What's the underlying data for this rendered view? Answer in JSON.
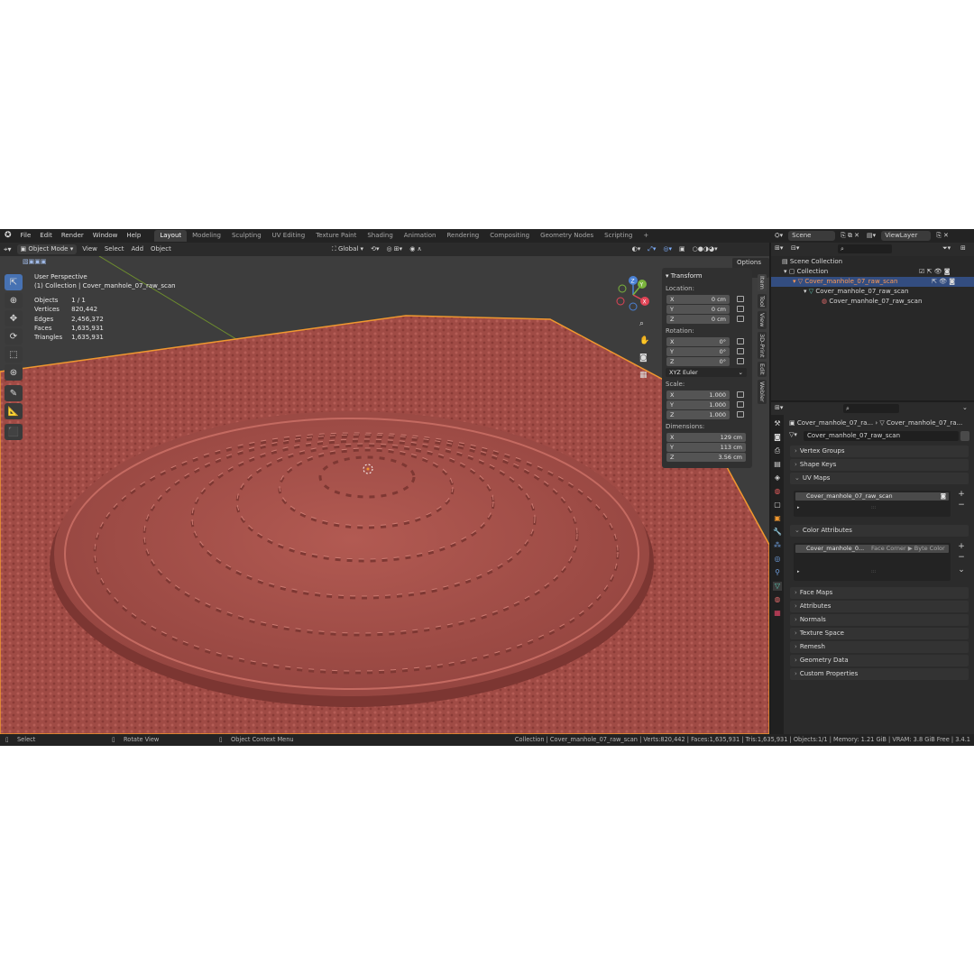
{
  "menu": {
    "items": [
      "File",
      "Edit",
      "Render",
      "Window",
      "Help"
    ],
    "workspaces": [
      "Layout",
      "Modeling",
      "Sculpting",
      "UV Editing",
      "Texture Paint",
      "Shading",
      "Animation",
      "Rendering",
      "Compositing",
      "Geometry Nodes",
      "Scripting"
    ],
    "active_workspace": "Layout",
    "add_symbol": "+"
  },
  "scene": {
    "label": "Scene",
    "view_layer": "ViewLayer"
  },
  "viewport_header": {
    "mode": "Object Mode",
    "menus": [
      "View",
      "Select",
      "Add",
      "Object"
    ],
    "orientation": "Global",
    "options": "Options"
  },
  "viewport_info": {
    "perspective": "User Perspective",
    "collection": "(1) Collection | Cover_manhole_07_raw_scan",
    "stats": [
      {
        "label": "Objects",
        "value": "1 / 1"
      },
      {
        "label": "Vertices",
        "value": "820,442"
      },
      {
        "label": "Edges",
        "value": "2,456,372"
      },
      {
        "label": "Faces",
        "value": "1,635,931"
      },
      {
        "label": "Triangles",
        "value": "1,635,931"
      }
    ]
  },
  "gizmo": {
    "x": "X",
    "y": "Y",
    "z": "Z"
  },
  "transform": {
    "title": "Transform",
    "location_label": "Location:",
    "location": [
      {
        "axis": "X",
        "value": "0 cm"
      },
      {
        "axis": "Y",
        "value": "0 cm"
      },
      {
        "axis": "Z",
        "value": "0 cm"
      }
    ],
    "rotation_label": "Rotation:",
    "rotation": [
      {
        "axis": "X",
        "value": "0°"
      },
      {
        "axis": "Y",
        "value": "0°"
      },
      {
        "axis": "Z",
        "value": "0°"
      }
    ],
    "rotation_mode": "XYZ Euler",
    "scale_label": "Scale:",
    "scale": [
      {
        "axis": "X",
        "value": "1.000"
      },
      {
        "axis": "Y",
        "value": "1.000"
      },
      {
        "axis": "Z",
        "value": "1.000"
      }
    ],
    "dimensions_label": "Dimensions:",
    "dimensions": [
      {
        "axis": "X",
        "value": "129 cm"
      },
      {
        "axis": "Y",
        "value": "113 cm"
      },
      {
        "axis": "Z",
        "value": "3.56 cm"
      }
    ]
  },
  "n_tabs": [
    "Item",
    "Tool",
    "View",
    "3D-Print",
    "Edit",
    "Webler"
  ],
  "outliner": {
    "rows": [
      {
        "label": "Scene Collection"
      },
      {
        "label": "Collection"
      },
      {
        "label": "Cover_manhole_07_raw_scan"
      },
      {
        "label": "Cover_manhole_07_raw_scan"
      },
      {
        "label": "Cover_manhole_07_raw_scan"
      }
    ]
  },
  "properties": {
    "breadcrumb_object": "Cover_manhole_07_ra...",
    "breadcrumb_data": "Cover_manhole_07_ra...",
    "mesh_name": "Cover_manhole_07_raw_scan",
    "panels_top": [
      "Vertex Groups",
      "Shape Keys"
    ],
    "uv_maps": {
      "title": "UV Maps",
      "item": "Cover_manhole_07_raw_scan"
    },
    "color_attributes": {
      "title": "Color Attributes",
      "item": "Cover_manhole_0...",
      "domain": "Face Corner ▶ Byte Color"
    },
    "panels_bottom": [
      "Face Maps",
      "Attributes",
      "Normals",
      "Texture Space",
      "Remesh",
      "Geometry Data",
      "Custom Properties"
    ]
  },
  "statusbar": {
    "select": "Select",
    "rotate": "Rotate View",
    "context": "Object Context Menu",
    "info": "Collection | Cover_manhole_07_raw_scan | Verts:820,442 | Faces:1,635,931 | Tris:1,635,931 | Objects:1/1 | Memory: 1.21 GiB | VRAM: 3.8 GiB Free | 3.4.1"
  },
  "colors": {
    "mesh": "#a4514b",
    "mesh_dark": "#7c3632",
    "selection_outline": "#f0982f",
    "active_blue": "#4772b3",
    "background": "#3d3d3d"
  }
}
